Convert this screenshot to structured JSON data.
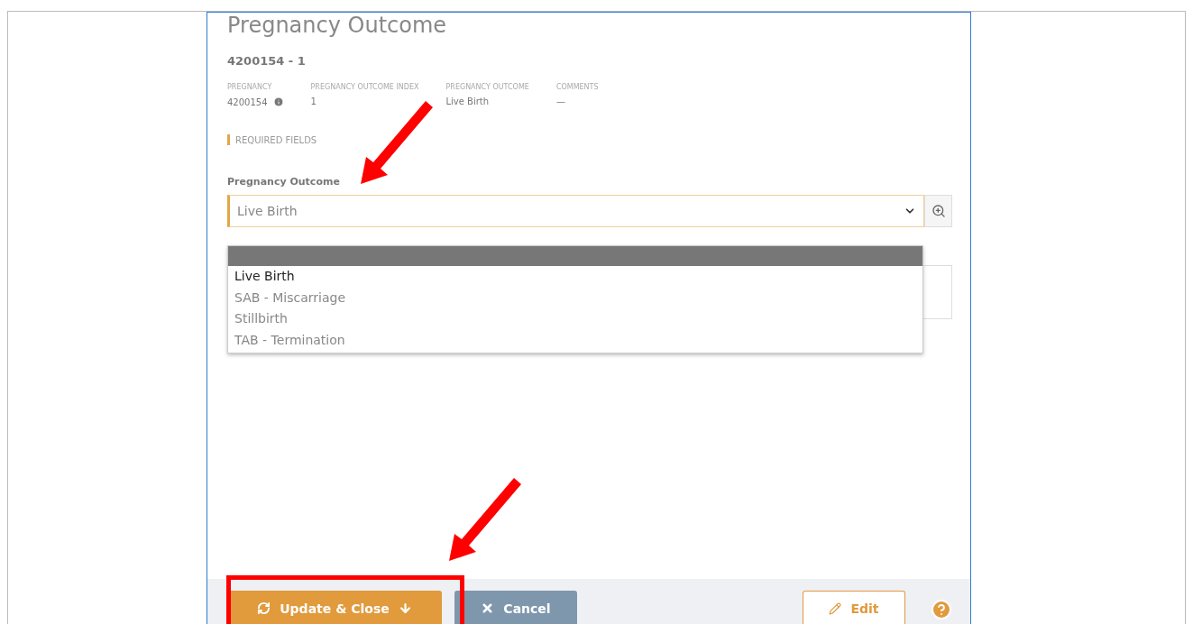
{
  "dialog": {
    "title": "Pregnancy Outcome",
    "record_id": "4200154 - 1",
    "details": [
      {
        "label": "PREGNANCY",
        "value": "4200154",
        "info": true
      },
      {
        "label": "PREGNANCY OUTCOME INDEX",
        "value": "1",
        "info": false
      },
      {
        "label": "PREGNANCY OUTCOME",
        "value": "Live Birth",
        "info": false
      },
      {
        "label": "COMMENTS",
        "value": "—",
        "info": false
      }
    ],
    "required_note": "REQUIRED FIELDS",
    "field": {
      "label": "Pregnancy Outcome",
      "value": "Live Birth",
      "required": true,
      "expanded": true
    },
    "dropdown": {
      "blank_option_highlighted": true,
      "options": [
        {
          "label": "Live Birth",
          "selected": true
        },
        {
          "label": "SAB - Miscarriage",
          "selected": false
        },
        {
          "label": "Stillbirth",
          "selected": false
        },
        {
          "label": "TAB - Termination",
          "selected": false
        }
      ]
    },
    "footer": {
      "buttons": [
        {
          "kind": "primary",
          "label": "Update & Close"
        },
        {
          "kind": "secondary",
          "label": "Cancel"
        },
        {
          "kind": "outline",
          "label": "Edit"
        }
      ]
    }
  }
}
